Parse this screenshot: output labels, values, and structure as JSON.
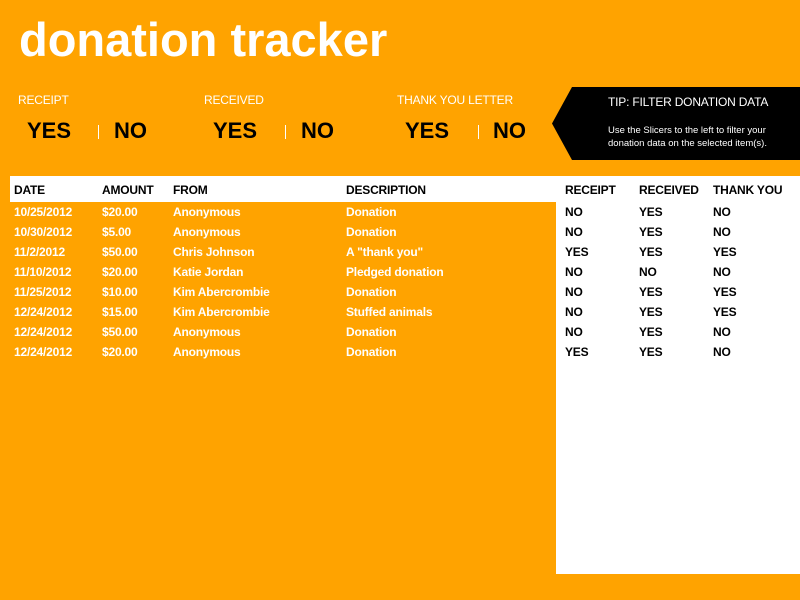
{
  "title": "donation tracker",
  "slicers": [
    {
      "label": "RECEIPT",
      "options": [
        "YES",
        "NO"
      ]
    },
    {
      "label": "RECEIVED",
      "options": [
        "YES",
        "NO"
      ]
    },
    {
      "label": "THANK YOU LETTER",
      "options": [
        "YES",
        "NO"
      ]
    }
  ],
  "tip": {
    "title": "TIP: FILTER DONATION DATA",
    "body": "Use the Slicers to the left to filter your donation data on the selected item(s)."
  },
  "table": {
    "headers": [
      "DATE",
      "AMOUNT",
      "FROM",
      "DESCRIPTION",
      "RECEIPT",
      "RECEIVED",
      "THANK YOU"
    ],
    "rows": [
      [
        "10/25/2012",
        "$20.00",
        "Anonymous",
        "Donation",
        "NO",
        "YES",
        "NO"
      ],
      [
        "10/30/2012",
        "$5.00",
        "Anonymous",
        "Donation",
        "NO",
        "YES",
        "NO"
      ],
      [
        "11/2/2012",
        "$50.00",
        "Chris Johnson",
        "A \"thank you\"",
        "YES",
        "YES",
        "YES"
      ],
      [
        "11/10/2012",
        "$20.00",
        "Katie Jordan",
        "Pledged donation",
        "NO",
        "NO",
        "NO"
      ],
      [
        "11/25/2012",
        "$10.00",
        "Kim Abercrombie",
        "Donation",
        "NO",
        "YES",
        "YES"
      ],
      [
        "12/24/2012",
        "$15.00",
        "Kim Abercrombie",
        "Stuffed animals",
        "NO",
        "YES",
        "YES"
      ],
      [
        "12/24/2012",
        "$50.00",
        "Anonymous",
        "Donation",
        "NO",
        "YES",
        "NO"
      ],
      [
        "12/24/2012",
        "$20.00",
        "Anonymous",
        "Donation",
        "YES",
        "YES",
        "NO"
      ]
    ]
  },
  "colors": {
    "background": "#FFA300",
    "tip_background": "#000000",
    "panel": "#FFFFFF"
  }
}
